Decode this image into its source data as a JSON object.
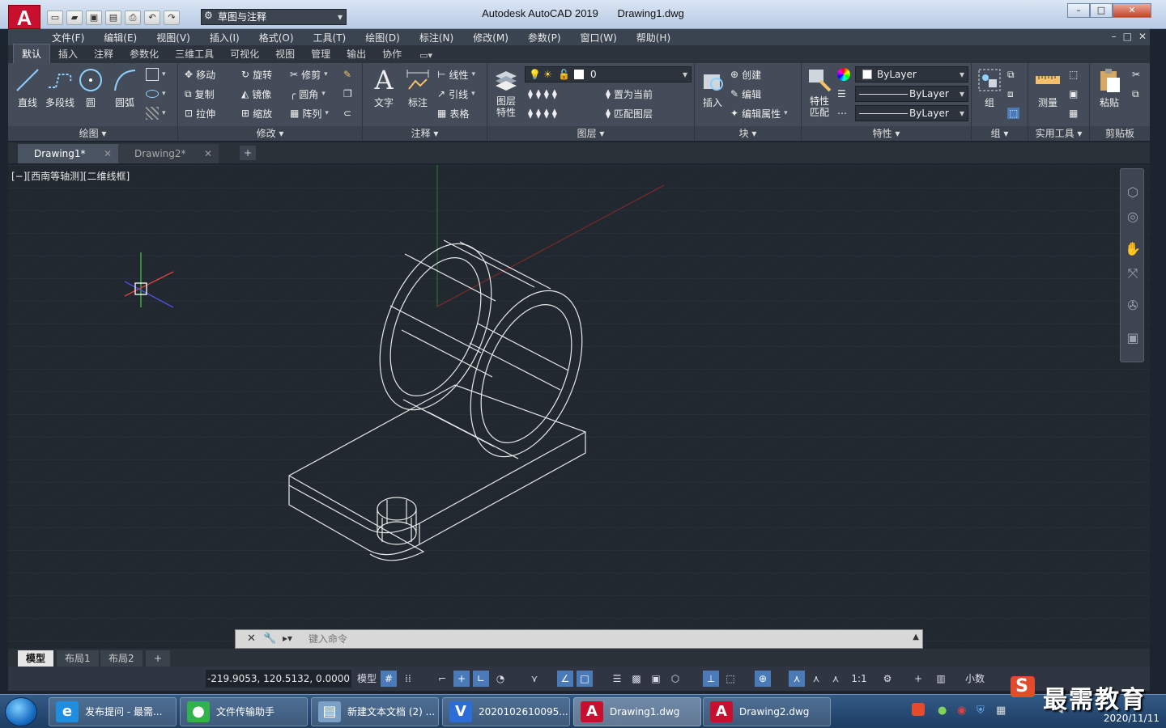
{
  "app": {
    "logo_letter": "A",
    "title": "Autodesk AutoCAD 2019",
    "filename": "Drawing1.dwg",
    "workspace": "草图与注释"
  },
  "window_controls": {
    "minimize": "–",
    "restore": "□",
    "close": "✕"
  },
  "menu": [
    "文件(F)",
    "编辑(E)",
    "视图(V)",
    "插入(I)",
    "格式(O)",
    "工具(T)",
    "绘图(D)",
    "标注(N)",
    "修改(M)",
    "参数(P)",
    "窗口(W)",
    "帮助(H)"
  ],
  "ribbon_tabs": [
    "默认",
    "插入",
    "注释",
    "参数化",
    "三维工具",
    "可视化",
    "视图",
    "管理",
    "输出",
    "协作"
  ],
  "ribbon": {
    "draw": {
      "title": "绘图 ▾",
      "line": "直线",
      "polyline": "多段线",
      "circle": "圆",
      "arc": "圆弧"
    },
    "modify": {
      "title": "修改 ▾",
      "move": "移动",
      "rotate": "旋转",
      "trim": "修剪",
      "copy": "复制",
      "mirror": "镜像",
      "fillet": "圆角",
      "stretch": "拉伸",
      "scale": "缩放",
      "array": "阵列"
    },
    "annotation": {
      "title": "注释 ▾",
      "text": "文字",
      "dimension": "标注",
      "linear": "线性",
      "leader": "引线",
      "table": "表格"
    },
    "layers": {
      "title": "图层 ▾",
      "layer_props": "图层\n特性",
      "current_layer": "0",
      "set_current": "置为当前",
      "match_layer": "匹配图层"
    },
    "block": {
      "title": "块 ▾",
      "insert": "插入",
      "create": "创建",
      "edit": "编辑",
      "edit_attr": "编辑属性"
    },
    "properties": {
      "title": "特性 ▾",
      "match": "特性\n匹配",
      "color": "ByLayer",
      "linetype": "ByLayer",
      "lineweight": "ByLayer"
    },
    "groups": {
      "title": "组 ▾",
      "group": "组"
    },
    "utilities": {
      "title": "实用工具 ▾",
      "measure": "测量"
    },
    "clipboard": {
      "title": "剪贴板",
      "paste": "粘贴"
    }
  },
  "doc_tabs": [
    {
      "label": "Drawing1*",
      "active": true
    },
    {
      "label": "Drawing2*",
      "active": false
    }
  ],
  "viewport_label": "[−][西南等轴测][二维线框]",
  "command": {
    "placeholder": "键入命令"
  },
  "layout_tabs": [
    "模型",
    "布局1",
    "布局2"
  ],
  "status": {
    "coords": "-219.9053, 120.5132, 0.0000",
    "model": "模型",
    "scale": "1:1",
    "units": "小数"
  },
  "taskbar": [
    {
      "label": "发布提问 - 最需...",
      "icon_color": "#1f8ee0",
      "icon": "e"
    },
    {
      "label": "文件传输助手",
      "icon_color": "#2fb34a",
      "icon": "●"
    },
    {
      "label": "新建文本文档 (2) ...",
      "icon_color": "#7aa0c8",
      "icon": "▤"
    },
    {
      "label": "2020102610095...",
      "icon_color": "#2c6ed5",
      "icon": "V"
    },
    {
      "label": "Drawing1.dwg",
      "icon_color": "#c8102e",
      "icon": "A"
    },
    {
      "label": "Drawing2.dwg",
      "icon_color": "#c8102e",
      "icon": "A"
    }
  ],
  "clock": {
    "date": "2020/11/11"
  },
  "watermark": "最需教育"
}
